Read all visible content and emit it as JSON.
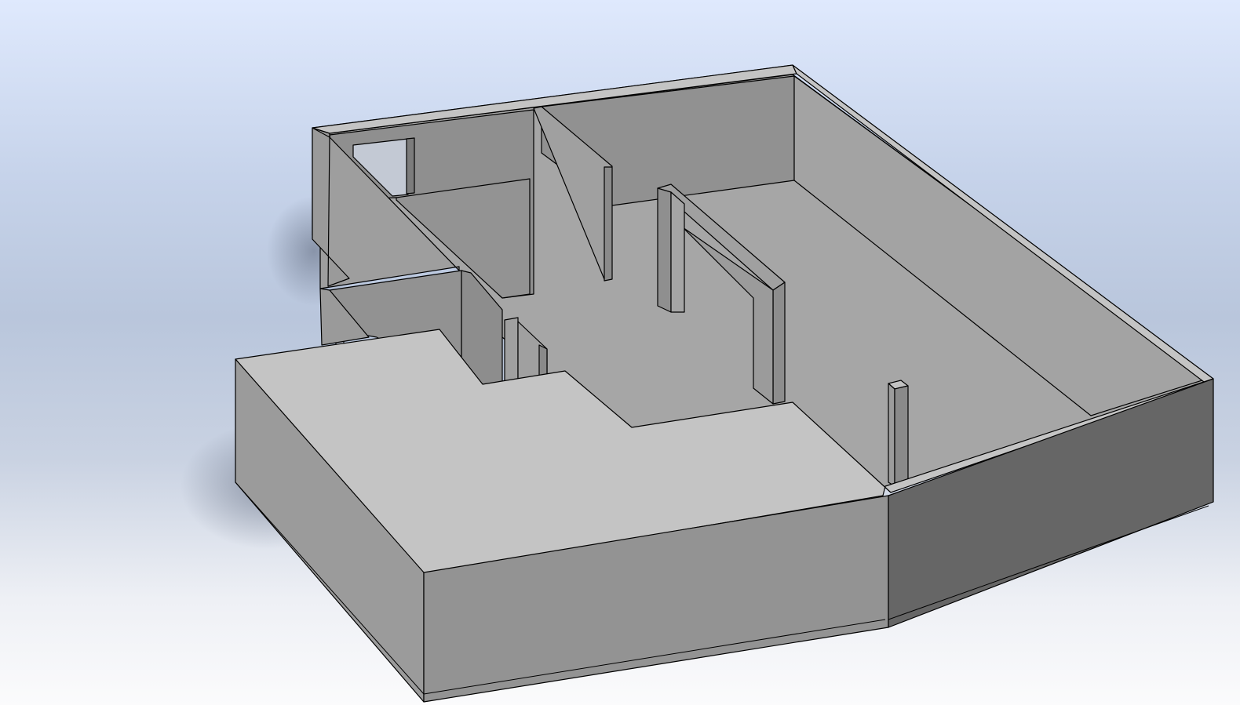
{
  "viewport": {
    "background_top": "#dfe9fd",
    "background_bottom": "#fbfbfc",
    "content": "3d-floor-plan-model"
  },
  "model": {
    "colors": {
      "floor": "#a6a6a6",
      "wall_top": "#c2c2c2",
      "wall_lit": "#9a9a9a",
      "wall_mid": "#8f8f8f",
      "wall_dark": "#666666",
      "edge": "#000000"
    }
  }
}
